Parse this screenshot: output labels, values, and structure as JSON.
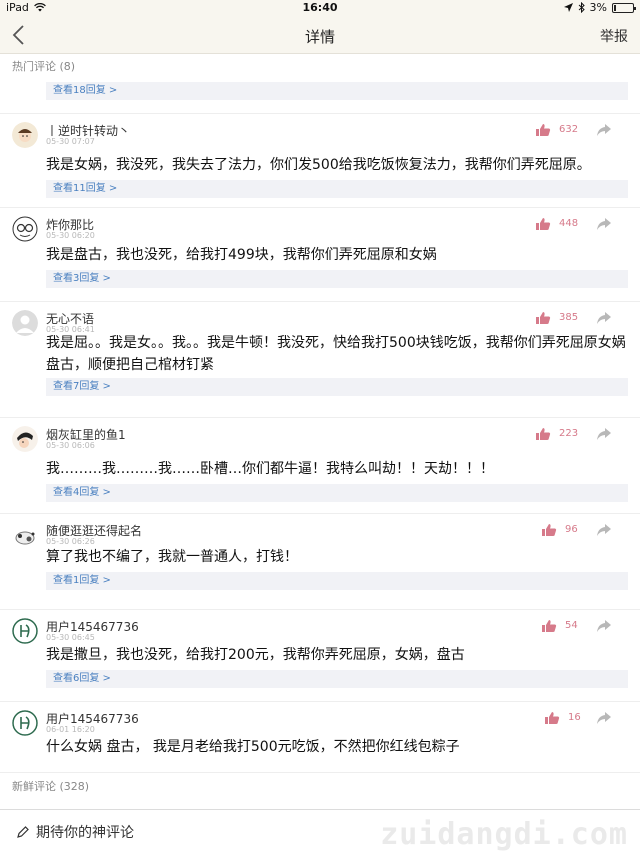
{
  "status_bar": {
    "device": "iPad",
    "time": "16:40",
    "battery": "3%"
  },
  "nav": {
    "title": "详情",
    "report": "举报"
  },
  "hot_label": "热门评论 (8)",
  "top_reply": "查看18回复 >",
  "comments": [
    {
      "name": "丨逆时针转动丶",
      "date": "05-30 07:07",
      "likes": "632",
      "text": "我是女娲，我没死，我失去了法力，你们发500给我吃饭恢复法力，我帮你们弄死屈原。",
      "replies": "查看11回复 >"
    },
    {
      "name": "炸你那比",
      "date": "05-30 06:20",
      "likes": "448",
      "text": "我是盘古，我也没死，给我打499块，我帮你们弄死屈原和女娲",
      "replies": "查看3回复 >"
    },
    {
      "name": "无心不语",
      "date": "05-30 06:41",
      "likes": "385",
      "text": "我是屈。。我是女。。我。。我是牛顿！我没死，快给我打500块钱吃饭，我帮你们弄死屈原女娲盘古，顺便把自己棺材钉紧",
      "replies": "查看7回复 >"
    },
    {
      "name": "烟灰缸里的鱼1",
      "date": "05-30 06:06",
      "likes": "223",
      "text": "我………我………我……卧槽…你们都牛逼！我特么叫劫！！天劫！！！",
      "replies": "查看4回复 >"
    },
    {
      "name": "随便逛逛还得起名",
      "date": "05-30 06:26",
      "likes": "96",
      "text": "算了我也不编了，我就一普通人，打钱！",
      "replies": "查看1回复 >"
    },
    {
      "name": "用户145467736",
      "date": "05-30 06:45",
      "likes": "54",
      "text": "我是撒旦，我也没死，给我打200元，我帮你弄死屈原，女娲，盘古",
      "replies": "查看6回复 >"
    },
    {
      "name": "用户145467736",
      "date": "06-01 16:20",
      "likes": "16",
      "text": "什么女娲 盘古， 我是月老给我打500元吃饭，不然把你红线包粽子",
      "replies": ""
    }
  ],
  "fresh_label": "新鲜评论 (328)",
  "footer": {
    "placeholder": "期待你的神评论",
    "watermark": "zuidangdi.com"
  },
  "colors": {
    "bar_bg": "#f8f6ef",
    "reply_bg": "#f1f2f6",
    "reply_link": "#4a80c0",
    "like": "#d67a8a",
    "share": "#b8b8b8"
  },
  "icons": [
    "chevron-left-icon",
    "wifi-icon",
    "location-icon",
    "bluetooth-icon",
    "battery-icon",
    "thumbs-up-icon",
    "share-arrow-icon",
    "pencil-icon"
  ]
}
